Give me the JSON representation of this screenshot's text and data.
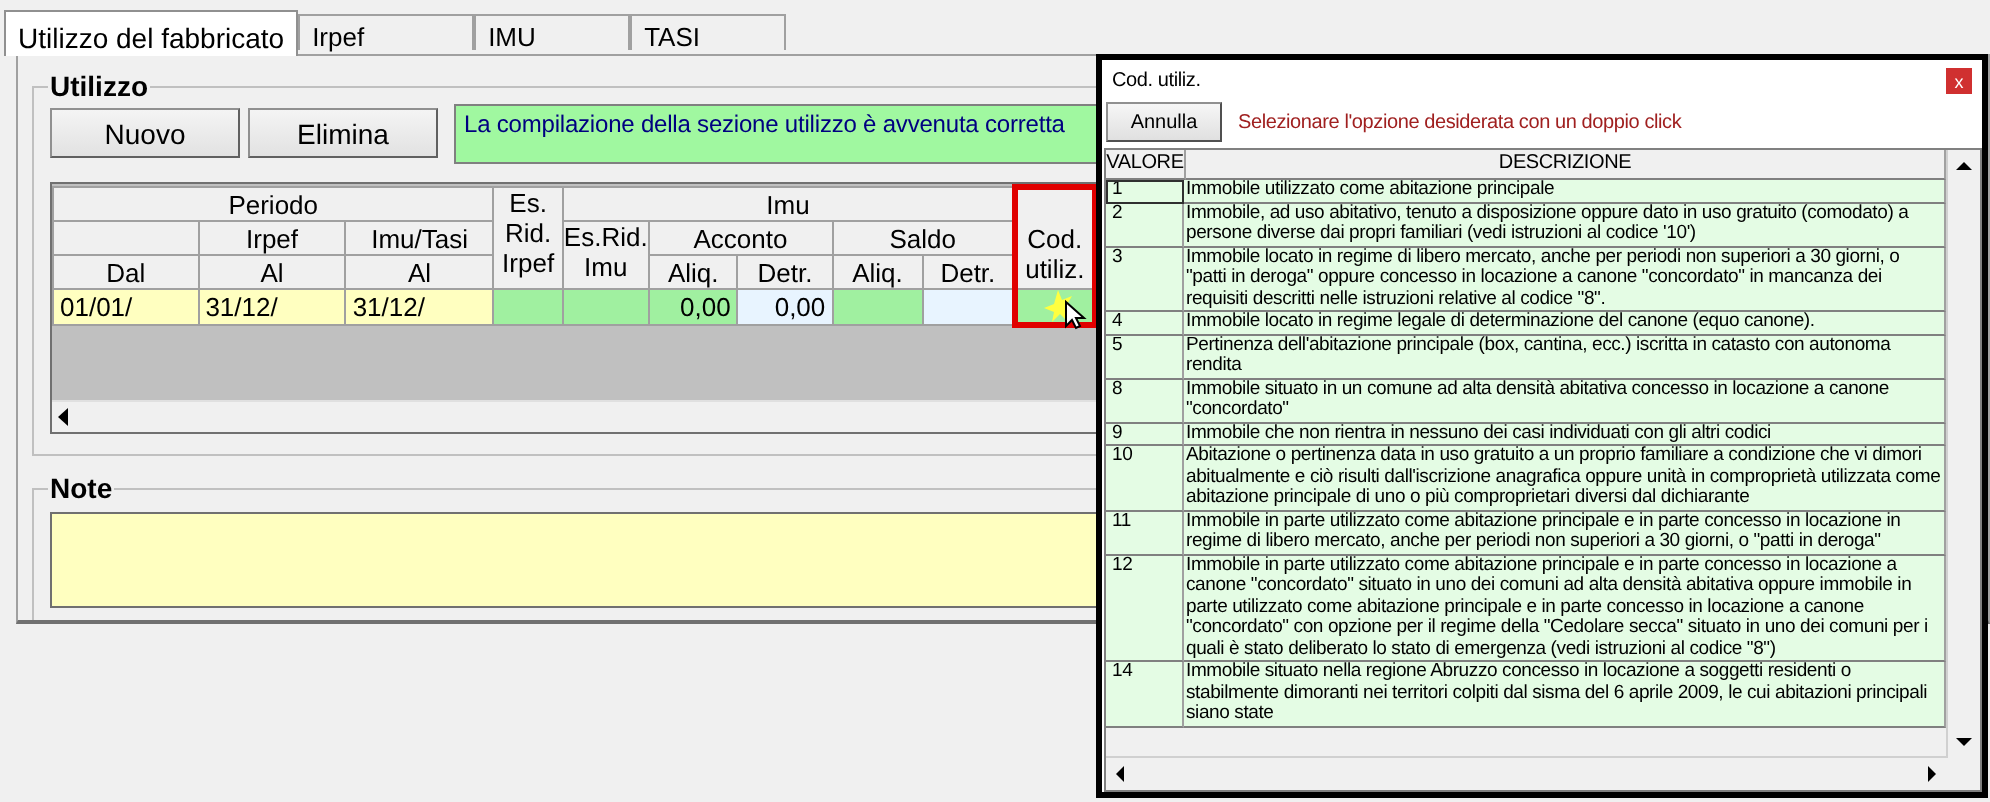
{
  "tabs": [
    {
      "label": "Utilizzo del fabbricato",
      "selected": true
    },
    {
      "label": "Irpef",
      "selected": false
    },
    {
      "label": "IMU",
      "selected": false
    },
    {
      "label": "TASI",
      "selected": false
    }
  ],
  "utilizzo": {
    "title": "Utilizzo",
    "buttons": [
      "Nuovo",
      "Elimina"
    ],
    "message": "La compilazione della sezione utilizzo è avvenuta corretta",
    "table": {
      "header": {
        "periodo": "Periodo",
        "irpef": "Irpef",
        "imu_tasi": "Imu/Tasi",
        "dal": "Dal",
        "al_irpef": "Al",
        "al_imu_tasi": "Al",
        "es_rid_irpef": "Es. Rid. Irpef",
        "imu": "Imu",
        "es_rid_imu": "Es.Rid. Imu",
        "acconto": "Acconto",
        "saldo": "Saldo",
        "aliq_acconto": "Aliq.",
        "detr_acconto": "Detr.",
        "aliq_saldo": "Aliq.",
        "detr_saldo": "Detr.",
        "cod_utiliz": "Cod. utiliz."
      },
      "cod_utiliz_highlighted": true,
      "rows": [
        {
          "cells": [
            {
              "value": "01/01/",
              "color": "#ffffc0"
            },
            {
              "value": "31/12/",
              "color": "#ffffc0"
            },
            {
              "value": "31/12/",
              "color": "#ffffc0"
            },
            {
              "color": "#a0f0a0"
            },
            {
              "color": "#a0f0a0"
            },
            {
              "value": "0,00",
              "color": "#a0f0a0"
            },
            {
              "value": "0,00",
              "color": "#e8f4ff"
            },
            {
              "color": "#a0f0a0"
            },
            {
              "color": "#e8f4ff"
            },
            {
              "color": "#a0f0a0"
            }
          ]
        }
      ]
    }
  },
  "note": {
    "title": "Note"
  },
  "popup": {
    "title": "Cod. utiliz.",
    "close": "x",
    "cancel": "Annulla",
    "hint": "Selezionare l'opzione desiderata con un doppio click",
    "columns": [
      "VALORE",
      "DESCRIZIONE"
    ],
    "rows": [
      {
        "value": "1",
        "description": "Immobile utilizzato come abitazione principale",
        "focused": true
      },
      {
        "value": "2",
        "description": "Immobile, ad uso abitativo, tenuto a disposizione oppure dato in uso gratuito (comodato) a persone diverse dai propri familiari (vedi istruzioni al codice '10')",
        "focused": false
      },
      {
        "value": "3",
        "description": "Immobile locato in regime di libero mercato, anche per periodi non superiori a 30 giorni, o \"patti in deroga\" oppure concesso in locazione a canone \"concordato\" in mancanza dei requisiti descritti nelle istruzioni relative al codice \"8\".",
        "focused": false
      },
      {
        "value": "4",
        "description": "Immobile locato in regime legale di determinazione del canone (equo canone).",
        "focused": false
      },
      {
        "value": "5",
        "description": "Pertinenza dell'abitazione principale (box, cantina, ecc.) iscritta in catasto con autonoma rendita",
        "focused": false
      },
      {
        "value": "8",
        "description": "Immobile situato in un comune ad alta densità abitativa concesso in locazione a canone \"concordato\"",
        "focused": false
      },
      {
        "value": "9",
        "description": "Immobile che non rientra in nessuno dei casi individuati con gli altri codici",
        "focused": false
      },
      {
        "value": "10",
        "description": "Abitazione o pertinenza data in uso gratuito a un proprio familiare a condizione che vi dimori abitualmente e ciò risulti dall'iscrizione anagrafica oppure unità in comproprietà utilizzata come abitazione principale di uno o più comproprietari diversi dal dichiarante",
        "focused": false
      },
      {
        "value": "11",
        "description": "Immobile in parte utilizzato come abitazione principale e in parte concesso in locazione in regime di libero mercato, anche per periodi non superiori a 30 giorni, o \"patti in deroga\"",
        "focused": false
      },
      {
        "value": "12",
        "description": "Immobile in parte utilizzato come abitazione principale e in parte concesso in locazione a canone \"concordato\" situato in uno dei comuni ad alta densità abitativa oppure immobile in parte utilizzato come abitazione principale e in parte concesso in locazione a canone \"concordato\" con opzione per il regime della \"Cedolare secca\" situato in uno dei comuni per i quali è stato deliberato lo stato di emergenza (vedi istruzioni al codice \"8\")",
        "focused": false
      },
      {
        "value": "14",
        "description": "Immobile situato nella regione Abruzzo concesso in locazione a soggetti residenti o stabilmente dimoranti nei territori colpiti dal sisma del 6 aprile 2009, le cui abitazioni principali siano state",
        "focused": false
      }
    ]
  }
}
